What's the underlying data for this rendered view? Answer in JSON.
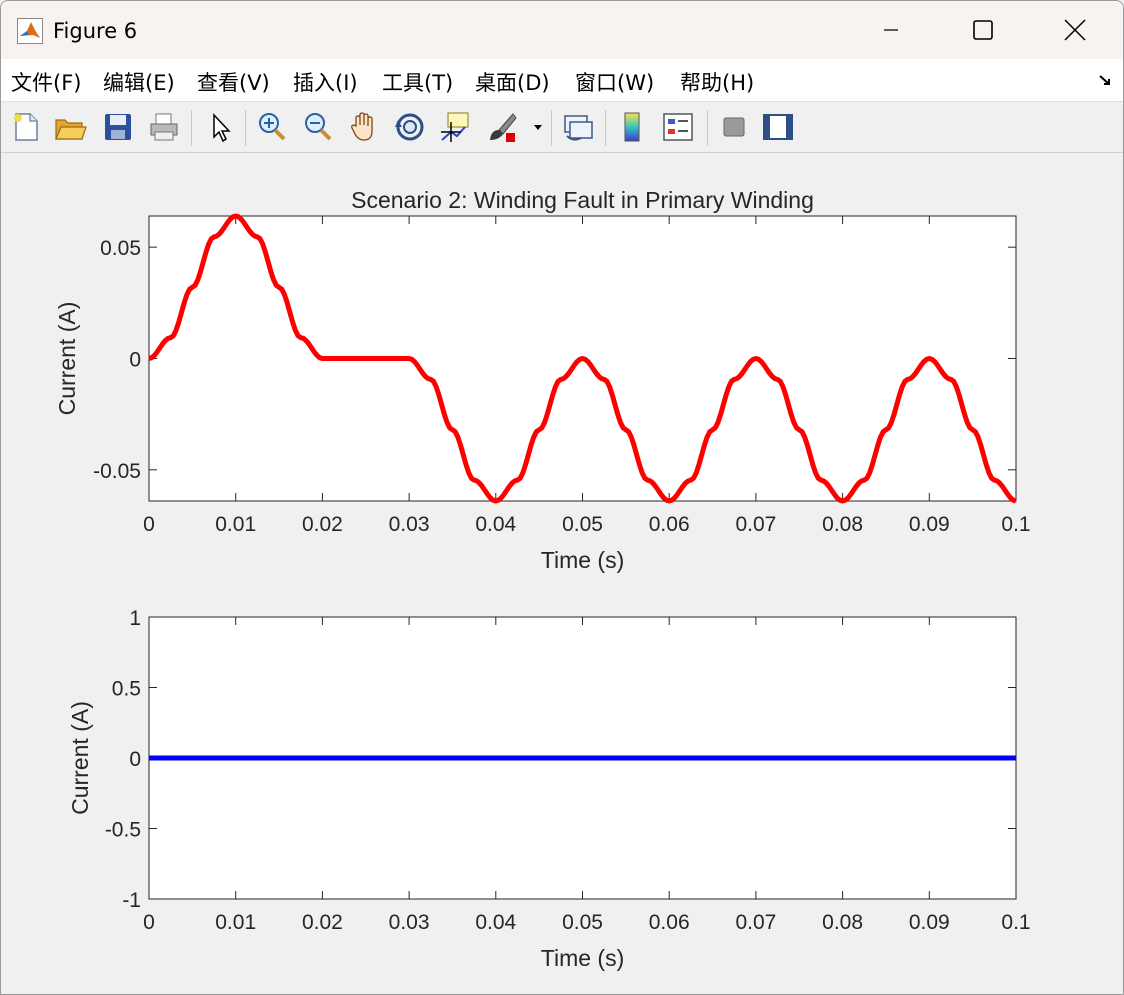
{
  "window": {
    "title": "Figure 6"
  },
  "menu": {
    "items": [
      {
        "label": "文件(F)",
        "name": "menu-file"
      },
      {
        "label": "编辑(E)",
        "name": "menu-edit"
      },
      {
        "label": "查看(V)",
        "name": "menu-view"
      },
      {
        "label": "插入(I)",
        "name": "menu-insert"
      },
      {
        "label": "工具(T)",
        "name": "menu-tools"
      },
      {
        "label": "桌面(D)",
        "name": "menu-desktop"
      },
      {
        "label": "窗口(W)",
        "name": "menu-window"
      },
      {
        "label": "帮助(H)",
        "name": "menu-help"
      }
    ]
  },
  "toolbar": {
    "icons": [
      "new-figure-icon",
      "open-file-icon",
      "save-icon",
      "print-icon",
      "pointer-icon",
      "zoom-in-icon",
      "zoom-out-icon",
      "pan-hand-icon",
      "rotate-3d-icon",
      "data-cursor-icon",
      "brush-icon",
      "brush-dropdown-icon",
      "link-plot-icon",
      "colorbar-icon",
      "legend-icon",
      "hide-plot-tools-icon",
      "show-plot-tools-icon"
    ]
  },
  "chart_data": [
    {
      "type": "line",
      "title": "Scenario 2: Winding Fault in Primary Winding",
      "xlabel": "Time (s)",
      "ylabel": "Current (A)",
      "xlim": [
        0,
        0.1
      ],
      "ylim": [
        -0.064,
        0.064
      ],
      "xticks": [
        "0",
        "0.01",
        "0.02",
        "0.03",
        "0.04",
        "0.05",
        "0.06",
        "0.07",
        "0.08",
        "0.09",
        "0.1"
      ],
      "yticks": [
        "-0.05",
        "0",
        "0.05"
      ],
      "ytick_values": [
        -0.05,
        0,
        0.05
      ],
      "color": "#ff0000",
      "series": [
        {
          "x": [
            0,
            0.0025,
            0.005,
            0.0075,
            0.01,
            0.0125,
            0.015,
            0.0175,
            0.02,
            0.025,
            0.03,
            0.0325,
            0.035,
            0.0375,
            0.04,
            0.0425,
            0.045,
            0.0475,
            0.05,
            0.0525,
            0.055,
            0.0575,
            0.06,
            0.0625,
            0.065,
            0.0675,
            0.07,
            0.0725,
            0.075,
            0.0775,
            0.08,
            0.0825,
            0.085,
            0.0875,
            0.09,
            0.0925,
            0.095,
            0.0975,
            0.1
          ],
          "y": [
            0,
            0.0094,
            0.032,
            0.0546,
            0.064,
            0.0546,
            0.032,
            0.0094,
            0,
            0,
            0,
            -0.0094,
            -0.032,
            -0.0546,
            -0.064,
            -0.0546,
            -0.032,
            -0.0094,
            0,
            -0.0094,
            -0.032,
            -0.0546,
            -0.064,
            -0.0546,
            -0.032,
            -0.0094,
            0,
            -0.0094,
            -0.032,
            -0.0546,
            -0.064,
            -0.0546,
            -0.032,
            -0.0094,
            0,
            -0.0094,
            -0.032,
            -0.0546,
            -0.064
          ]
        }
      ]
    },
    {
      "type": "line",
      "title": "",
      "xlabel": "Time (s)",
      "ylabel": "Current (A)",
      "xlim": [
        0,
        0.1
      ],
      "ylim": [
        -1,
        1
      ],
      "xticks": [
        "0",
        "0.01",
        "0.02",
        "0.03",
        "0.04",
        "0.05",
        "0.06",
        "0.07",
        "0.08",
        "0.09",
        "0.1"
      ],
      "yticks": [
        "-1",
        "-0.5",
        "0",
        "0.5",
        "1"
      ],
      "ytick_values": [
        -1,
        -0.5,
        0,
        0.5,
        1
      ],
      "color": "#0000ff",
      "series": [
        {
          "x": [
            0,
            0.1
          ],
          "y": [
            0,
            0
          ]
        }
      ]
    }
  ]
}
